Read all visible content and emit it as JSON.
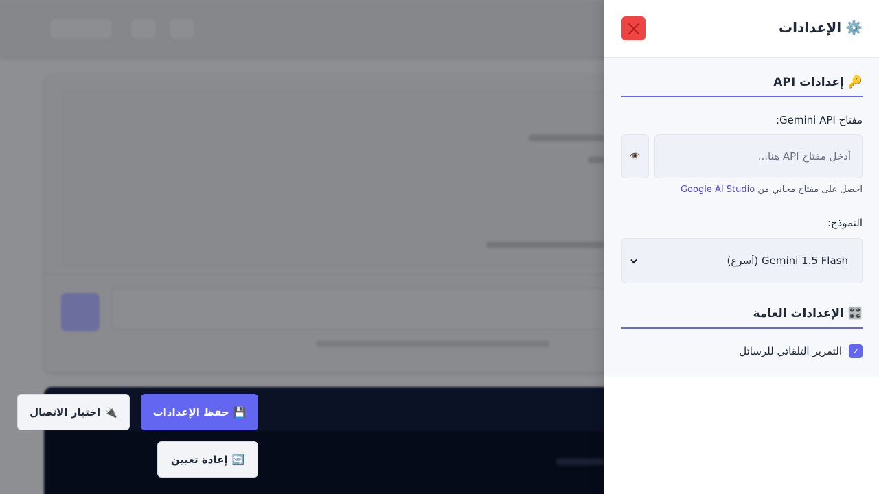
{
  "panel": {
    "title": "الإعدادات",
    "title_icon": "⚙️",
    "close_icon": "close-icon"
  },
  "api_section": {
    "icon": "🔑",
    "title": "إعدادات API",
    "key_label": "مفتاح Gemini API:",
    "key_placeholder": "أدخل مفتاح API هنا...",
    "key_value": "",
    "toggle_icon": "👁️",
    "help_prefix": "احصل على مفتاح مجاني من",
    "help_link": "Google AI Studio",
    "model_label": "النموذج:",
    "model_selected": "Gemini 1.5 Flash (أسرع)",
    "chevron": "⌄"
  },
  "general_section": {
    "icon": "🎛️",
    "title": "الإعدادات العامة",
    "auto_scroll_label": "التمرير التلقائي للرسائل",
    "auto_scroll_checked": true,
    "check_mark": "✓"
  },
  "footer": {
    "save_icon": "💾",
    "save_label": "حفظ الإعدادات",
    "test_icon": "🔌",
    "test_label": "اختبار الاتصال",
    "reset_icon": "🔄",
    "reset_label": "إعادة تعيين"
  },
  "colors": {
    "accent": "#6366f1",
    "danger": "#ef4444",
    "overlay": "#8e8f92"
  }
}
